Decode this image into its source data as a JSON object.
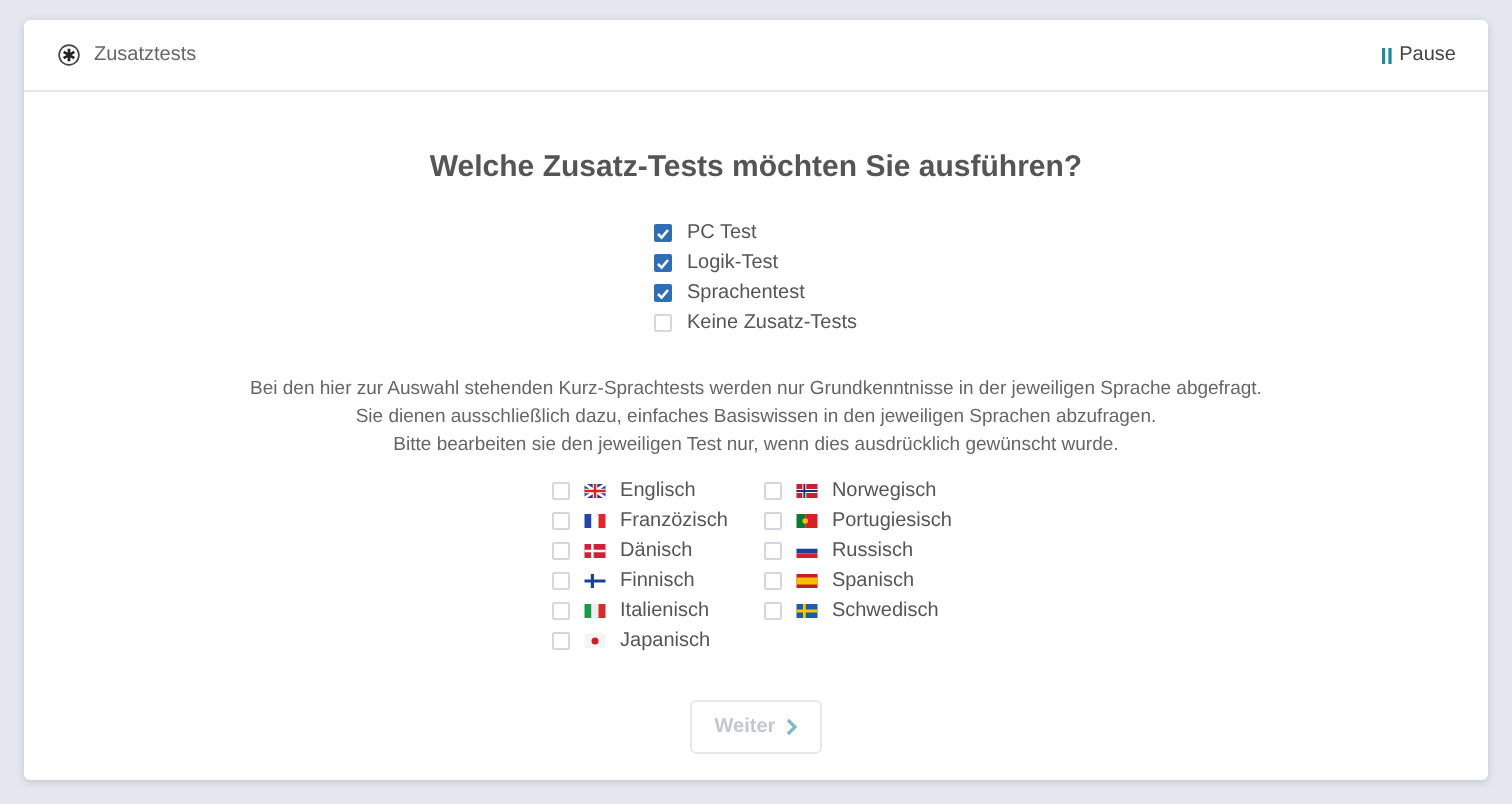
{
  "header": {
    "title": "Zusatztests",
    "pause": "Pause"
  },
  "question": "Welche Zusatz-Tests möchten Sie ausführen?",
  "tests": [
    {
      "label": "PC Test",
      "checked": true
    },
    {
      "label": "Logik-Test",
      "checked": true
    },
    {
      "label": "Sprachentest",
      "checked": true
    },
    {
      "label": "Keine Zusatz-Tests",
      "checked": false
    }
  ],
  "info": [
    "Bei den hier zur Auswahl stehenden Kurz-Sprachtests werden nur Grundkenntnisse in der jeweiligen Sprache abgefragt.",
    "Sie dienen ausschließlich dazu, einfaches Basiswissen in den jeweiligen Sprachen abzufragen.",
    "Bitte bearbeiten sie den jeweiligen Test nur, wenn dies ausdrücklich gewünscht wurde."
  ],
  "languages": [
    [
      {
        "label": "Englisch",
        "checked": false
      },
      {
        "label": "Franzözisch",
        "checked": false
      },
      {
        "label": "Dänisch",
        "checked": false
      },
      {
        "label": "Finnisch",
        "checked": false
      },
      {
        "label": "Italienisch",
        "checked": false
      },
      {
        "label": "Japanisch",
        "checked": false
      }
    ],
    [
      {
        "label": "Norwegisch",
        "checked": false
      },
      {
        "label": "Portugiesisch",
        "checked": false
      },
      {
        "label": "Russisch",
        "checked": false
      },
      {
        "label": "Spanisch",
        "checked": false
      },
      {
        "label": "Schwedisch",
        "checked": false
      }
    ]
  ],
  "next_button": {
    "label": "Weiter",
    "disabled": true
  }
}
